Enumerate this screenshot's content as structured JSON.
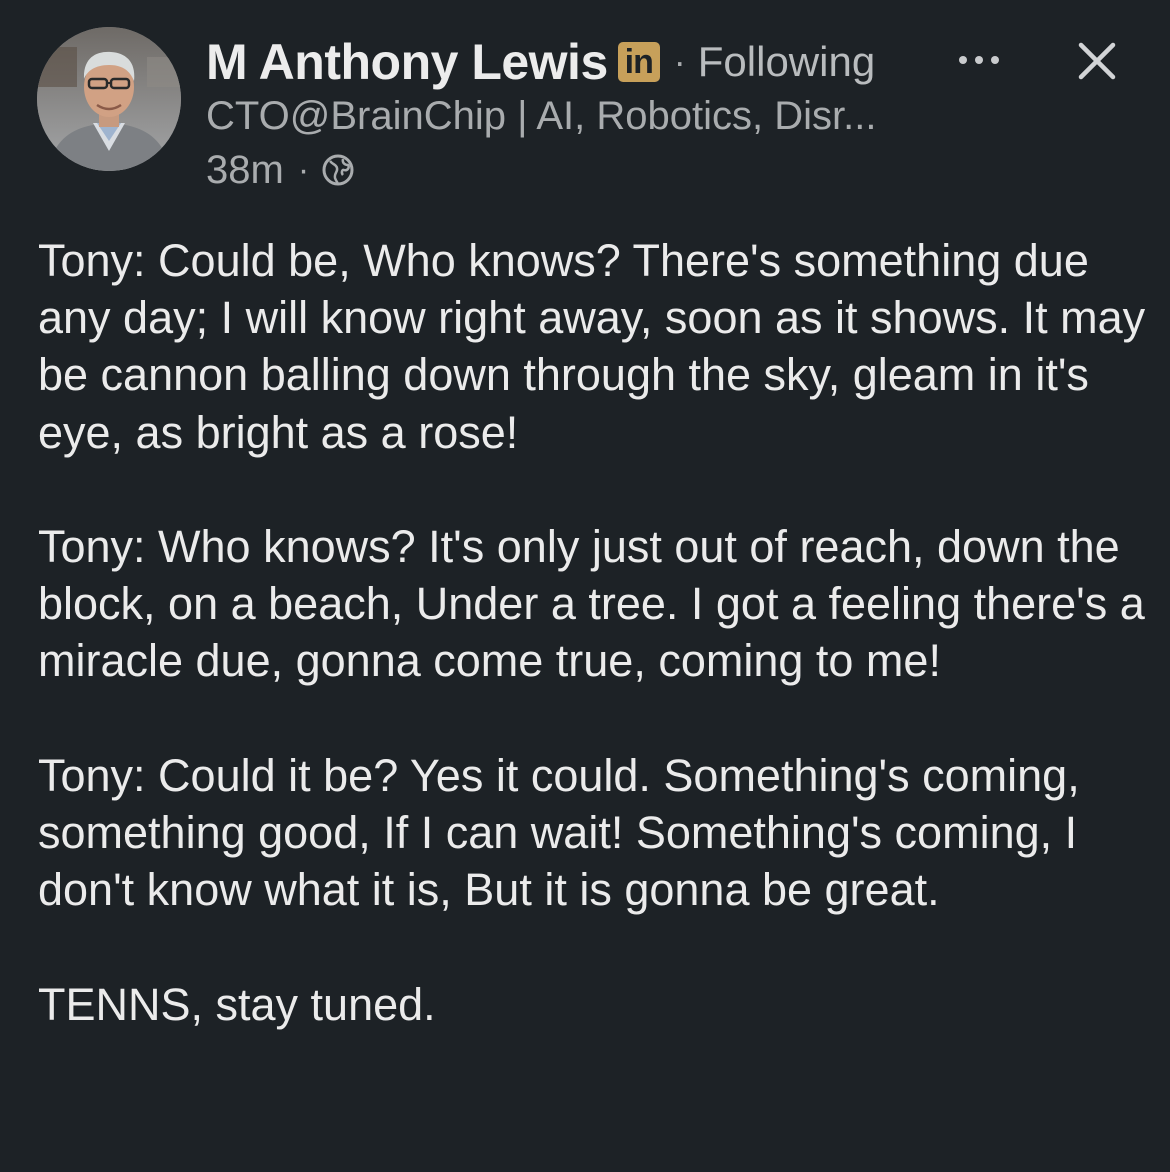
{
  "author": {
    "name": "M Anthony Lewis",
    "badge": "in",
    "separator": "·",
    "follow_status": "Following",
    "headline": "CTO@BrainChip | AI, Robotics, Disr...",
    "timestamp": "38m",
    "meta_separator": "·",
    "visibility_icon": "globe-icon",
    "avatar_icon": "profile-photo"
  },
  "actions": {
    "more_icon": "more-options-icon",
    "close_icon": "close-icon"
  },
  "post": {
    "paragraphs": [
      "Tony: Could be, Who knows? There's something due any day; I will know right away, soon as it shows. It may be cannon balling down through the sky, gleam in it's eye, as bright as a rose!",
      "Tony: Who knows? It's only just out of reach, down the block, on a beach, Under a tree. I got a feeling there's a miracle due, gonna come true, coming to me!",
      "Tony: Could it be? Yes it could. Something's coming, something good, If I can wait! Something's coming, I don't know what it is, But it is gonna be great.",
      "TENNS, stay tuned."
    ]
  },
  "colors": {
    "background": "#1d2226",
    "text_primary": "#ebebeb",
    "text_secondary": "#a9acae",
    "badge": "#c7a05a"
  }
}
